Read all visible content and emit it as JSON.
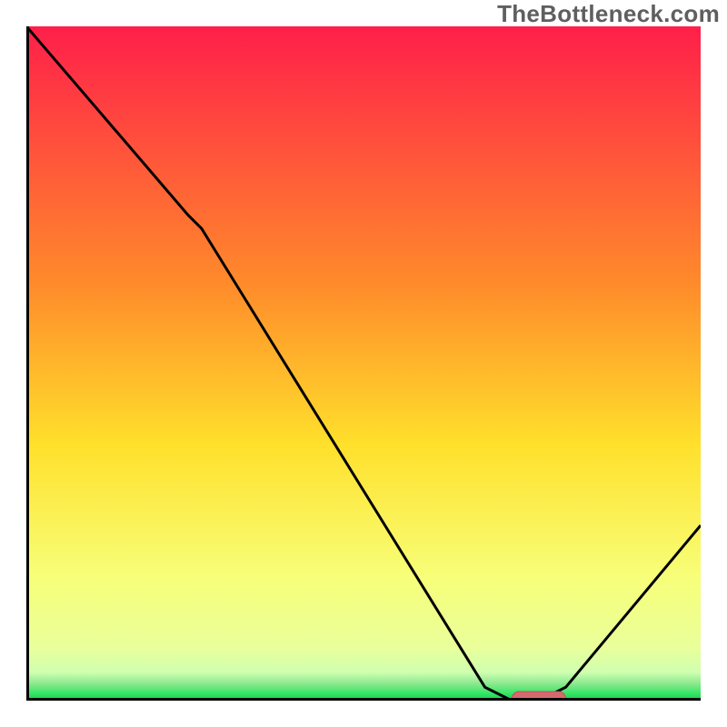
{
  "watermark": "TheBottleneck.com",
  "colors": {
    "top": "#ff1f4a",
    "mid_upper": "#ff8a2b",
    "mid": "#ffe02b",
    "lower": "#f7ff7a",
    "band_pale": "#cfffb0",
    "band_green": "#31e664",
    "axis": "#000000",
    "curve": "#000000",
    "marker_fill": "#d46a70",
    "marker_stroke": "#c94f56"
  },
  "chart_data": {
    "type": "line",
    "title": "",
    "xlabel": "",
    "ylabel": "",
    "xlim": [
      0,
      100
    ],
    "ylim": [
      0,
      100
    ],
    "series": [
      {
        "name": "bottleneck-curve",
        "x": [
          0,
          24,
          25,
          26,
          68,
          72,
          76,
          80,
          100
        ],
        "y": [
          100,
          72,
          71,
          70,
          2,
          0,
          0,
          2,
          26
        ]
      }
    ],
    "marker": {
      "x_start": 72,
      "x_end": 80,
      "y": 0
    },
    "gradient_bands": [
      {
        "stop": 0.0,
        "color": "#ff1f4a"
      },
      {
        "stop": 0.38,
        "color": "#ff8a2b"
      },
      {
        "stop": 0.62,
        "color": "#ffe02b"
      },
      {
        "stop": 0.82,
        "color": "#f7ff7a"
      },
      {
        "stop": 0.92,
        "color": "#eaff9a"
      },
      {
        "stop": 0.958,
        "color": "#cfffb0"
      },
      {
        "stop": 0.975,
        "color": "#8be88e"
      },
      {
        "stop": 0.99,
        "color": "#31e664"
      },
      {
        "stop": 1.0,
        "color": "#18c94f"
      }
    ]
  }
}
